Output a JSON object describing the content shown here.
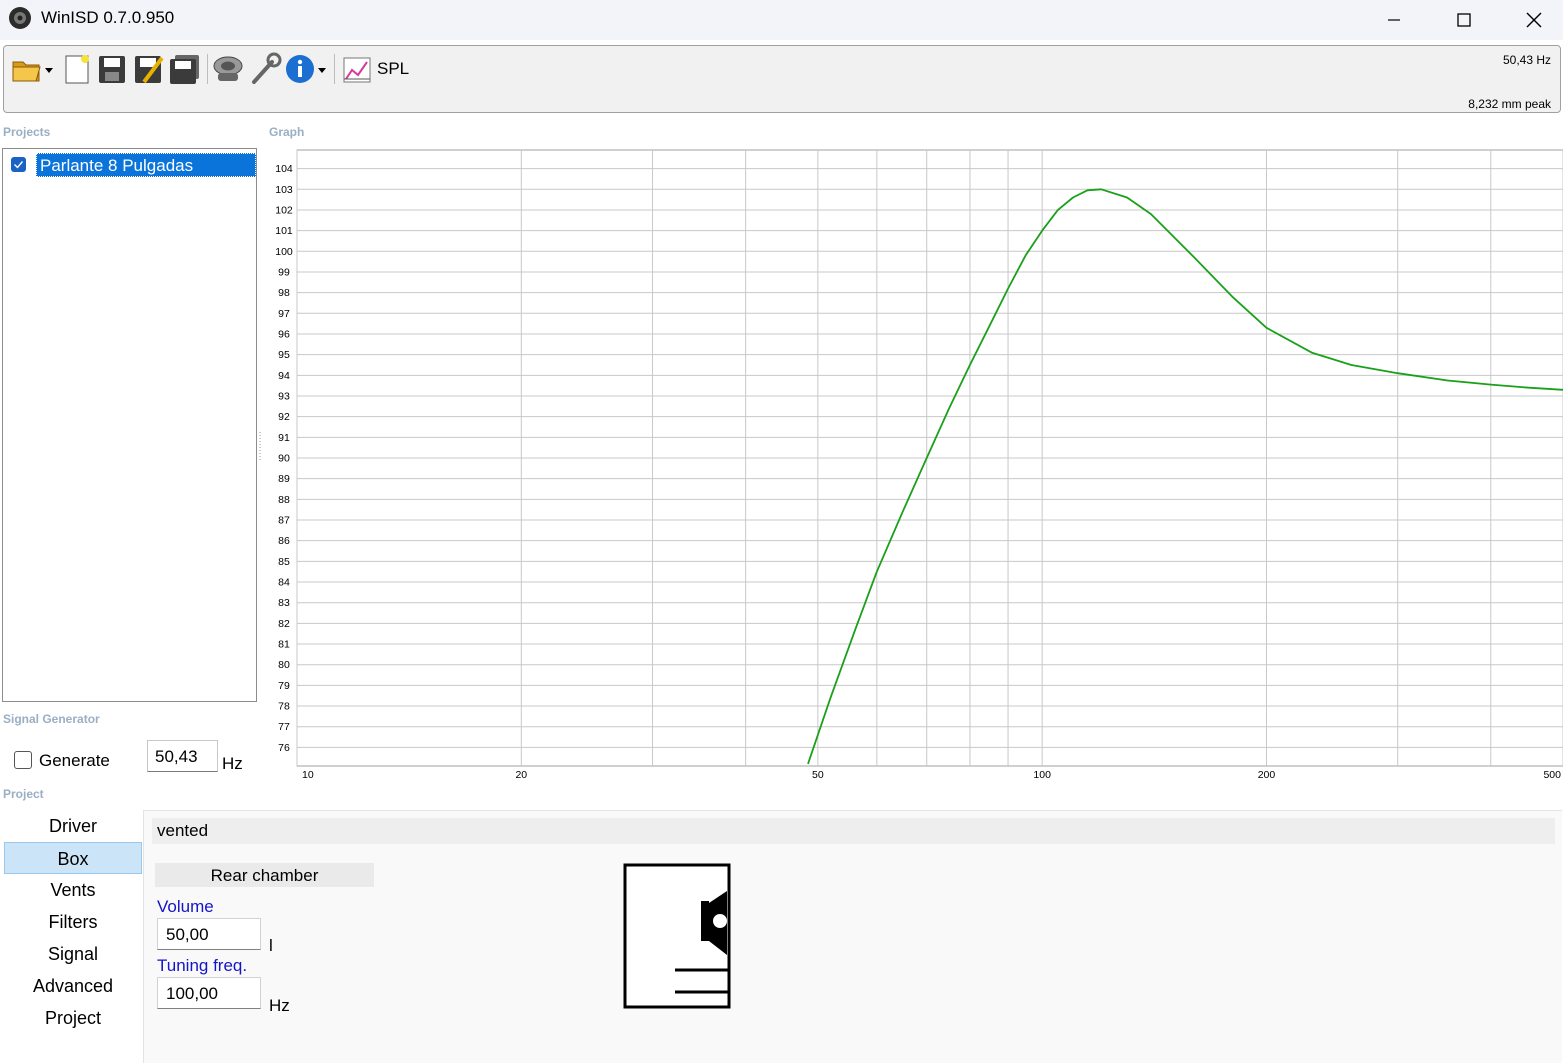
{
  "window": {
    "title": "WinISD 0.7.0.950"
  },
  "toolbar": {
    "spl_label": "SPL",
    "status_freq": "50,43 Hz",
    "status_peak": "8,232 mm peak"
  },
  "sections": {
    "projects": "Projects",
    "graph": "Graph",
    "signal_generator": "Signal Generator",
    "project": "Project"
  },
  "projects": {
    "items": [
      {
        "name": "Parlante 8 Pulgadas",
        "checked": true
      }
    ]
  },
  "signal_generator": {
    "generate_label": "Generate",
    "generate_checked": false,
    "frequency": "50,43",
    "unit": "Hz"
  },
  "project_nav": {
    "items": [
      "Driver",
      "Box",
      "Vents",
      "Filters",
      "Signal",
      "Advanced",
      "Project"
    ],
    "active": "Box"
  },
  "box": {
    "type": "vented",
    "chamber_header": "Rear chamber",
    "volume_label": "Volume",
    "volume_value": "50,00",
    "volume_unit": "l",
    "tuning_label": "Tuning freq.",
    "tuning_value": "100,00",
    "tuning_unit": "Hz"
  },
  "chart_data": {
    "type": "line",
    "title": "",
    "xlabel": "",
    "ylabel": "",
    "x_scale": "log",
    "xlim": [
      10,
      500
    ],
    "ylim": [
      75.1,
      104.9
    ],
    "x_ticks": [
      10,
      20,
      50,
      100,
      200,
      500
    ],
    "x_gridlines": [
      10,
      20,
      30,
      40,
      50,
      60,
      70,
      80,
      90,
      100,
      200,
      300,
      400,
      500
    ],
    "y_ticks": [
      76,
      77,
      78,
      79,
      80,
      81,
      82,
      83,
      84,
      85,
      86,
      87,
      88,
      89,
      90,
      91,
      92,
      93,
      94,
      95,
      96,
      97,
      98,
      99,
      100,
      101,
      102,
      103,
      104
    ],
    "grid": true,
    "series": [
      {
        "color": "#1aa01a",
        "x": [
          48.5,
          52,
          56,
          60,
          65,
          70,
          75,
          80,
          85,
          90,
          95,
          100,
          105,
          110,
          115,
          120,
          130,
          140,
          160,
          180,
          200,
          230,
          260,
          300,
          350,
          400,
          450,
          500
        ],
        "y": [
          75.2,
          78.4,
          81.6,
          84.5,
          87.4,
          90.0,
          92.4,
          94.5,
          96.4,
          98.2,
          99.8,
          101.0,
          102.0,
          102.6,
          102.95,
          103.0,
          102.6,
          101.8,
          99.7,
          97.8,
          96.3,
          95.1,
          94.5,
          94.1,
          93.75,
          93.55,
          93.4,
          93.3
        ]
      }
    ]
  }
}
